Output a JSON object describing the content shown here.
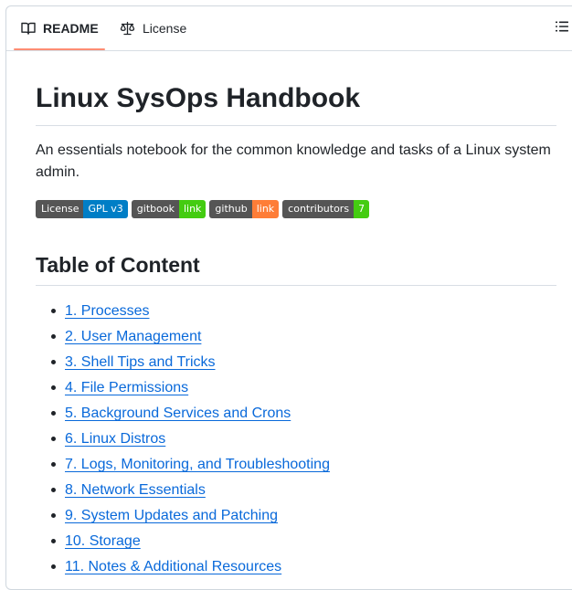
{
  "tabs": [
    {
      "label": "README",
      "icon": "book-icon",
      "active": true
    },
    {
      "label": "License",
      "icon": "scale-icon",
      "active": false
    }
  ],
  "toc_button_icon": "list-icon",
  "readme": {
    "title": "Linux SysOps Handbook",
    "description": "An essentials notebook for the common knowledge and tasks of a Linux system admin.",
    "badges": [
      {
        "left": "License",
        "right": "GPL v3",
        "color": "#007ec6"
      },
      {
        "left": "gitbook",
        "right": "link",
        "color": "#4c1"
      },
      {
        "left": "github",
        "right": "link",
        "color": "#fe7d37"
      },
      {
        "left": "contributors",
        "right": "7",
        "color": "#4c1"
      }
    ],
    "toc_heading": "Table of Content",
    "toc_items": [
      "1. Processes",
      "2. User Management",
      "3. Shell Tips and Tricks",
      "4. File Permissions",
      "5. Background Services and Crons",
      "6. Linux Distros",
      "7. Logs, Monitoring, and Troubleshooting",
      "8. Network Essentials",
      "9. System Updates and Patching",
      "10. Storage",
      "11. Notes & Additional Resources"
    ]
  },
  "colors": {
    "link": "#0969da",
    "active_tab_underline": "#fd8c73",
    "badge_label_bg": "#555555"
  }
}
